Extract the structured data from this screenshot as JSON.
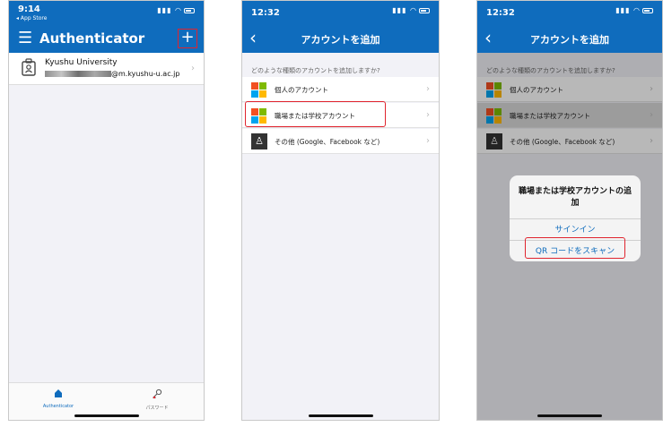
{
  "screen1": {
    "status": {
      "time": "9:14",
      "back_app": "◂ App Store"
    },
    "app_title": "Authenticator",
    "add_button": "+",
    "account": {
      "name": "Kyushu University",
      "email_suffix": "@m.kyushu-u.ac.jp"
    },
    "tabs": [
      {
        "label": "Authenticator",
        "icon": "lock-icon"
      },
      {
        "label": "パスワード",
        "icon": "key-icon"
      }
    ]
  },
  "screen2": {
    "status": {
      "time": "12:32"
    },
    "nav_title": "アカウントを追加",
    "question": "どのような種類のアカウントを追加しますか?",
    "options": [
      {
        "label": "個人のアカウント",
        "icon": "microsoft-logo-icon"
      },
      {
        "label": "職場または学校アカウント",
        "icon": "microsoft-logo-icon"
      },
      {
        "label": "その他 (Google、Facebook など)",
        "icon": "person-icon"
      }
    ]
  },
  "screen3": {
    "status": {
      "time": "12:32"
    },
    "nav_title": "アカウントを追加",
    "question": "どのような種類のアカウントを追加しますか?",
    "options": [
      {
        "label": "個人のアカウント"
      },
      {
        "label": "職場または学校アカウント"
      },
      {
        "label": "その他 (Google、Facebook など)"
      }
    ],
    "alert": {
      "title": "職場または学校アカウントの追加",
      "sign_in": "サインイン",
      "scan_qr": "QR コードをスキャン"
    }
  },
  "colors": {
    "brand": "#0f6cbd",
    "highlight": "#e0242e"
  }
}
